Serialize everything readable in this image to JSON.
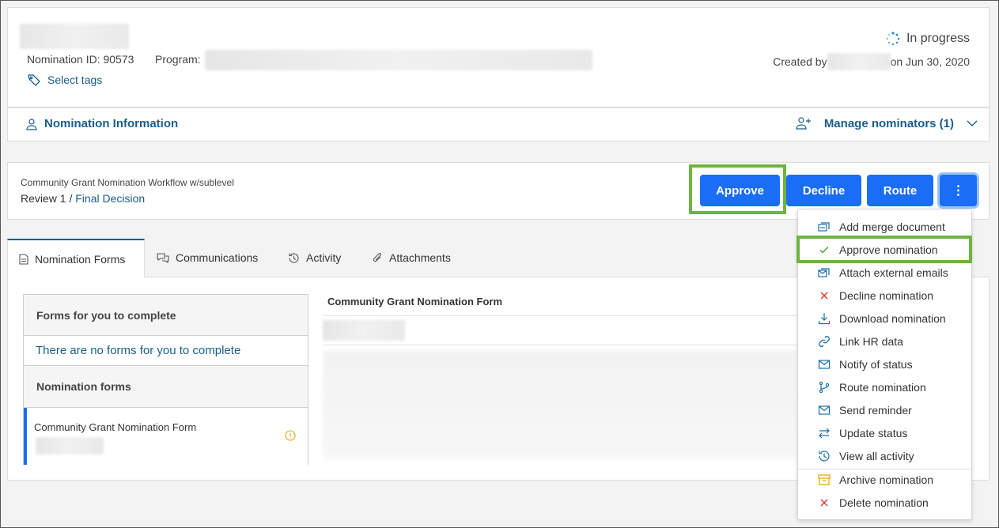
{
  "header": {
    "nomination_id": "Nomination ID: 90573",
    "program_label": "Program:",
    "select_tags": "Select tags",
    "status": "In progress",
    "created_by": "Created by",
    "created_on": "on Jun 30, 2020"
  },
  "info_bar": {
    "nomination_information": "Nomination Information",
    "manage_nominators": "Manage nominators (1)"
  },
  "workflow": {
    "name": "Community Grant Nomination Workflow w/sublevel",
    "level": "Review 1 /",
    "stage": "Final Decision"
  },
  "actions": {
    "approve": "Approve",
    "decline": "Decline",
    "route": "Route",
    "more": "⋮"
  },
  "tabs": [
    {
      "label": "Nomination Forms"
    },
    {
      "label": "Communications"
    },
    {
      "label": "Activity"
    },
    {
      "label": "Attachments"
    }
  ],
  "forms_panel": {
    "to_complete_header": "Forms for you to complete",
    "no_forms": "There are no forms for you to complete",
    "nomination_forms_header": "Nomination forms",
    "form_item": "Community Grant Nomination Form",
    "form_title": "Community Grant Nomination Form"
  },
  "menu": {
    "items": [
      {
        "label": "Add merge document",
        "icon": "merge-document-icon"
      },
      {
        "label": "Approve nomination",
        "icon": "check-icon"
      },
      {
        "label": "Attach external emails",
        "icon": "attach-email-icon"
      },
      {
        "label": "Decline nomination",
        "icon": "x-icon"
      },
      {
        "label": "Download nomination",
        "icon": "download-icon"
      },
      {
        "label": "Link HR data",
        "icon": "link-icon"
      },
      {
        "label": "Notify of status",
        "icon": "envelope-icon"
      },
      {
        "label": "Route nomination",
        "icon": "route-branch-icon"
      },
      {
        "label": "Send reminder",
        "icon": "envelope-icon"
      },
      {
        "label": "Update status",
        "icon": "swap-arrows-icon"
      },
      {
        "label": "View all activity",
        "icon": "history-icon"
      },
      {
        "label": "Archive nomination",
        "icon": "archive-icon"
      },
      {
        "label": "Delete nomination",
        "icon": "x-icon"
      }
    ]
  },
  "colors": {
    "primary_button": "#1a6ef5",
    "link": "#1a5e8a",
    "highlight": "#6db33f",
    "danger": "#d9372b",
    "warning": "#e0a800"
  }
}
